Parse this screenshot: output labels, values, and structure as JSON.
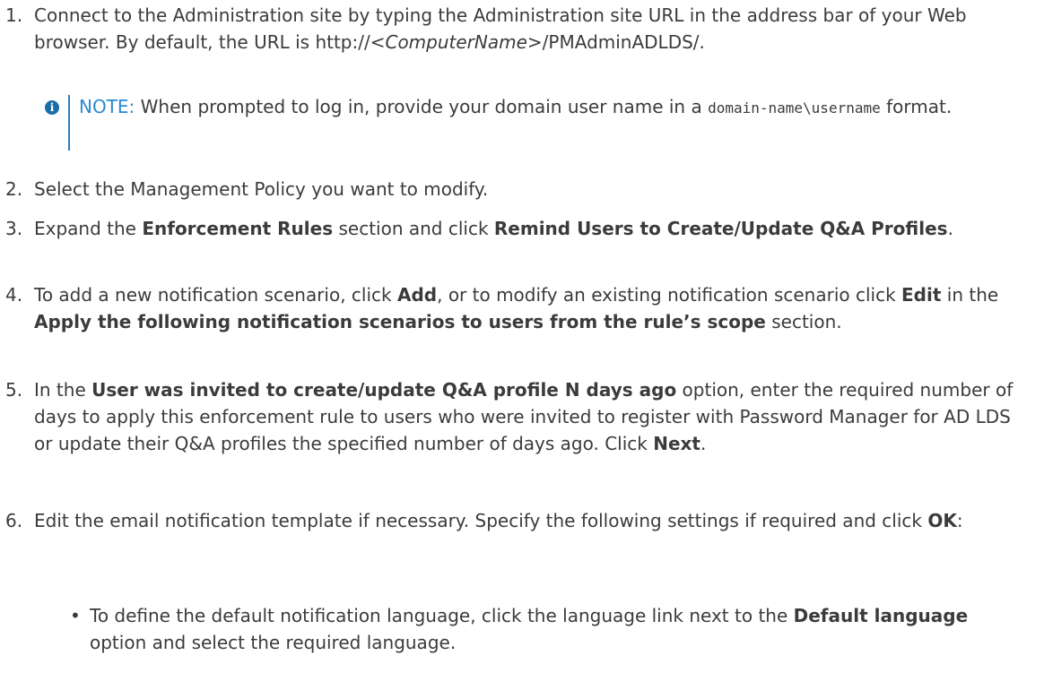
{
  "steps": [
    {
      "number": "1.",
      "text_a": "Connect to the Administration site by typing the Administration site URL in the address bar of your Web browser. By default, the URL is http://<",
      "text_italic": "ComputerName",
      "text_b": ">/PMAdminADLDS/."
    },
    {
      "number": "2.",
      "text": "Select the Management Policy you want to modify."
    },
    {
      "number": "3.",
      "text_a": "Expand the ",
      "bold_1": "Enforcement Rules",
      "text_b": " section and click ",
      "bold_2": "Remind Users to Create/Update Q&A Profiles",
      "text_c": "."
    },
    {
      "number": "4.",
      "text_a": "To add a new notification scenario, click ",
      "bold_1": "Add",
      "text_b": ", or to modify an existing notification scenario click ",
      "bold_2": "Edit",
      "text_c": " in the ",
      "bold_3": "Apply the following notification scenarios to users from the rule’s scope",
      "text_d": " section."
    },
    {
      "number": "5.",
      "text_a": "In the ",
      "bold_1": "User was invited to create/update Q&A profile N days ago",
      "text_b": " option, enter the required number of days to apply this enforcement rule to users who were invited to register with Password Manager for AD LDS or update their Q&A profiles the specified number of days ago. Click ",
      "bold_2": "Next",
      "text_c": "."
    },
    {
      "number": "6.",
      "text_a": "Edit the email notification template if necessary. Specify the following settings if required and click ",
      "bold_1": "OK",
      "text_b": ":"
    }
  ],
  "note": {
    "icon_glyph": "i",
    "label": "NOTE:",
    "text_a": " When prompted to log in, provide your domain user name in a ",
    "code": "domain-name\\username",
    "text_b": " format."
  },
  "bullet": {
    "glyph": "•",
    "text_a": "To define the default notification language, click the language link next to the ",
    "bold_1": "Default language",
    "text_b": " option and select the required language."
  }
}
